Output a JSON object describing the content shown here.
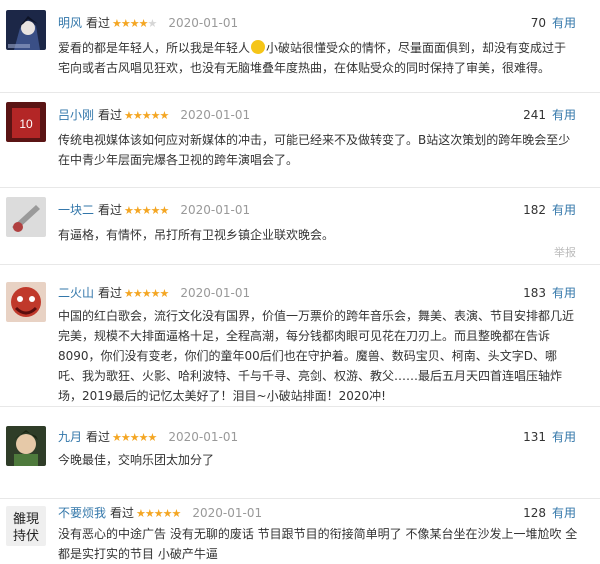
{
  "reviews": [
    {
      "user": "明风",
      "watched": "看过",
      "rating": 4,
      "date": "2020-01-01",
      "votes": "70",
      "useful": "有用",
      "content_a": "爱看的都是年轻人，所以我是年轻人",
      "content_b": "小破站很懂受众的情怀，尽量面面俱到，却没有变成过于宅向或者古风唱见狂欢，也没有无脑堆叠年度热曲，在体贴受众的同时保持了审美，很难得。",
      "avatar_color": "#1c2747"
    },
    {
      "user": "吕小刚",
      "watched": "看过",
      "rating": 5,
      "date": "2020-01-01",
      "votes": "241",
      "useful": "有用",
      "content": "传统电视媒体该如何应对新媒体的冲击，可能已经来不及做转变了。B站这次策划的跨年晚会至少在中青少年层面完爆各卫视的跨年演唱会了。",
      "avatar_color": "#8a1d1d"
    },
    {
      "user": "一块二",
      "watched": "看过",
      "rating": 5,
      "date": "2020-01-01",
      "votes": "182",
      "useful": "有用",
      "content": "有逼格，有情怀，吊打所有卫视乡镇企业联欢晚会。",
      "report": "举报",
      "avatar_color": "#c7c7c7"
    },
    {
      "user": "二火山",
      "watched": "看过",
      "rating": 5,
      "date": "2020-01-01",
      "votes": "183",
      "useful": "有用",
      "content": "中国的红白歌会，流行文化没有国界，价值一万票价的跨年音乐会，舞美、表演、节目安排都几近完美，规模不大排面逼格十足，全程高潮，每分钱都肉眼可见花在刀刃上。而且整晚都在告诉8090，你们没有变老，你们的童年00后们也在守护着。魔兽、数码宝贝、柯南、头文字D、哪吒、我为歌狂、火影、哈利波特、千与千寻、亮剑、权游、教父……最后五月天四首连唱压轴炸场，2019最后的记忆太美好了！泪目~小破站排面！2020冲!",
      "avatar_color": "#a8372c"
    },
    {
      "user": "九月",
      "watched": "看过",
      "rating": 5,
      "date": "2020-01-01",
      "votes": "131",
      "useful": "有用",
      "content": "今晚最佳，交响乐团太加分了",
      "avatar_color": "#4a6b3a"
    },
    {
      "user": "不要烦我",
      "watched": "看过",
      "rating": 5,
      "date": "2020-01-01",
      "votes": "128",
      "useful": "有用",
      "content": "没有恶心的中途广告 没有无聊的废话 节目跟节目的衔接简单明了 不像某台坐在沙发上一堆尬吹 全都是实打实的节目 小破产牛逼",
      "avatar_text": "雒現持伏",
      "avatar_color": "#efefef"
    }
  ]
}
